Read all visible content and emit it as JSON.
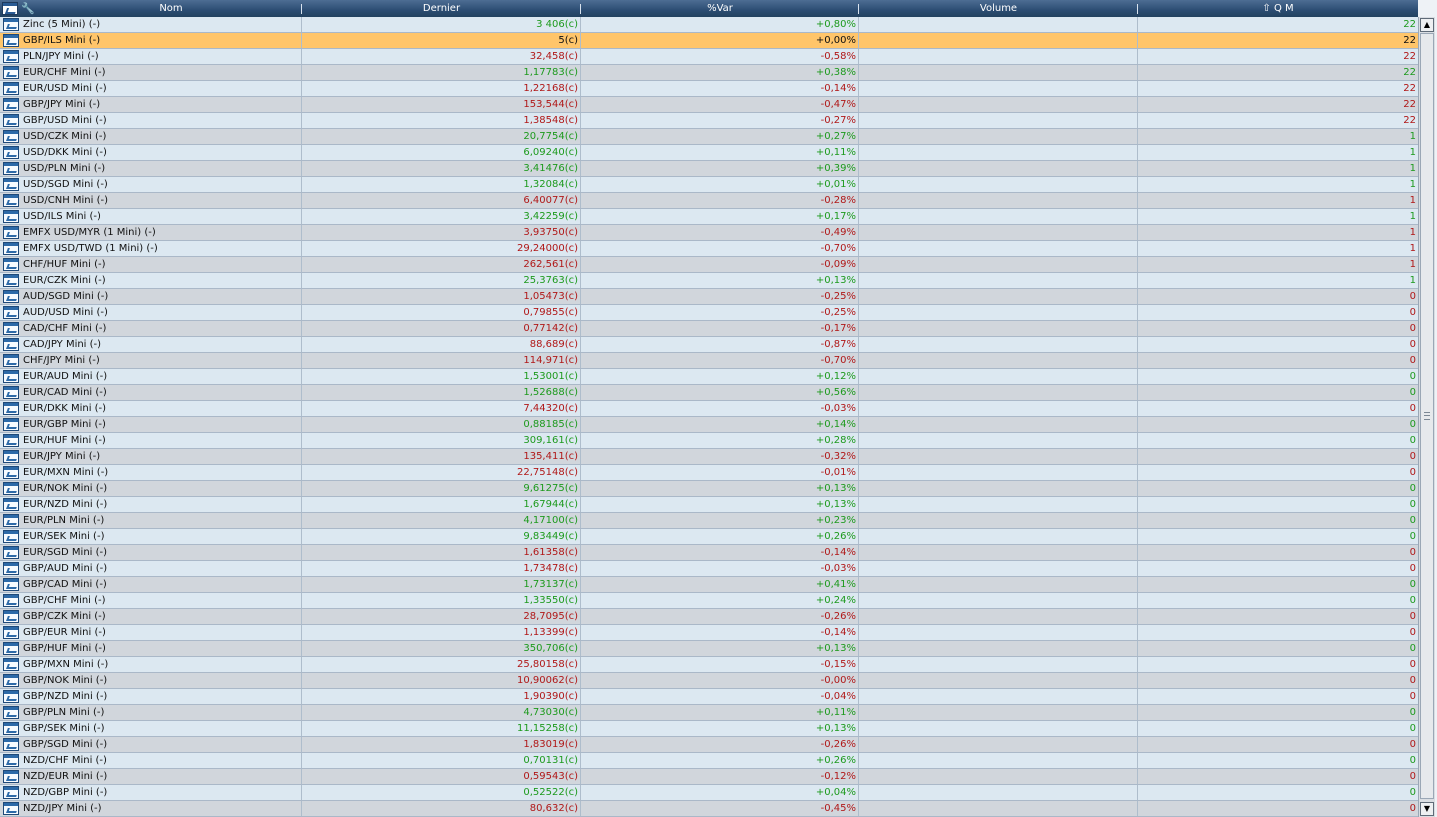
{
  "header": {
    "nom": "Nom",
    "dernier": "Dernier",
    "var": "%Var",
    "volume": "Volume",
    "qm": "Q M",
    "icons": [
      "window-chart-icon",
      "wrench-icon",
      "sort-up-arrow-icon"
    ]
  },
  "colors": {
    "up": "#1d9a1d",
    "down": "#b01818",
    "selected": "#ffc56a",
    "header": "#2c4d73"
  },
  "rows": [
    {
      "nom": "Zinc (5 Mini) (-)",
      "dernier": "3 406(c)",
      "var": "+0,80%",
      "volume": "",
      "qm": "22",
      "dir": "up"
    },
    {
      "nom": "GBP/ILS Mini (-)",
      "dernier": "5(c)",
      "var": "+0,00%",
      "volume": "",
      "qm": "22",
      "dir": "flat",
      "selected": true
    },
    {
      "nom": "PLN/JPY Mini (-)",
      "dernier": "32,458(c)",
      "var": "-0,58%",
      "volume": "",
      "qm": "22",
      "dir": "down"
    },
    {
      "nom": "EUR/CHF Mini (-)",
      "dernier": "1,17783(c)",
      "var": "+0,38%",
      "volume": "",
      "qm": "22",
      "dir": "up"
    },
    {
      "nom": "EUR/USD Mini (-)",
      "dernier": "1,22168(c)",
      "var": "-0,14%",
      "volume": "",
      "qm": "22",
      "dir": "down"
    },
    {
      "nom": "GBP/JPY Mini (-)",
      "dernier": "153,544(c)",
      "var": "-0,47%",
      "volume": "",
      "qm": "22",
      "dir": "down"
    },
    {
      "nom": "GBP/USD Mini (-)",
      "dernier": "1,38548(c)",
      "var": "-0,27%",
      "volume": "",
      "qm": "22",
      "dir": "down"
    },
    {
      "nom": "USD/CZK Mini (-)",
      "dernier": "20,7754(c)",
      "var": "+0,27%",
      "volume": "",
      "qm": "1",
      "dir": "up"
    },
    {
      "nom": "USD/DKK Mini (-)",
      "dernier": "6,09240(c)",
      "var": "+0,11%",
      "volume": "",
      "qm": "1",
      "dir": "up"
    },
    {
      "nom": "USD/PLN Mini (-)",
      "dernier": "3,41476(c)",
      "var": "+0,39%",
      "volume": "",
      "qm": "1",
      "dir": "up"
    },
    {
      "nom": "USD/SGD Mini (-)",
      "dernier": "1,32084(c)",
      "var": "+0,01%",
      "volume": "",
      "qm": "1",
      "dir": "up"
    },
    {
      "nom": "USD/CNH Mini (-)",
      "dernier": "6,40077(c)",
      "var": "-0,28%",
      "volume": "",
      "qm": "1",
      "dir": "down"
    },
    {
      "nom": "USD/ILS Mini (-)",
      "dernier": "3,42259(c)",
      "var": "+0,17%",
      "volume": "",
      "qm": "1",
      "dir": "up"
    },
    {
      "nom": "EMFX USD/MYR (1 Mini) (-)",
      "dernier": "3,93750(c)",
      "var": "-0,49%",
      "volume": "",
      "qm": "1",
      "dir": "down"
    },
    {
      "nom": "EMFX USD/TWD (1 Mini) (-)",
      "dernier": "29,24000(c)",
      "var": "-0,70%",
      "volume": "",
      "qm": "1",
      "dir": "down"
    },
    {
      "nom": "CHF/HUF Mini (-)",
      "dernier": "262,561(c)",
      "var": "-0,09%",
      "volume": "",
      "qm": "1",
      "dir": "down"
    },
    {
      "nom": "EUR/CZK Mini (-)",
      "dernier": "25,3763(c)",
      "var": "+0,13%",
      "volume": "",
      "qm": "1",
      "dir": "up"
    },
    {
      "nom": "AUD/SGD Mini (-)",
      "dernier": "1,05473(c)",
      "var": "-0,25%",
      "volume": "",
      "qm": "0",
      "dir": "down"
    },
    {
      "nom": "AUD/USD Mini (-)",
      "dernier": "0,79855(c)",
      "var": "-0,25%",
      "volume": "",
      "qm": "0",
      "dir": "down"
    },
    {
      "nom": "CAD/CHF Mini (-)",
      "dernier": "0,77142(c)",
      "var": "-0,17%",
      "volume": "",
      "qm": "0",
      "dir": "down"
    },
    {
      "nom": "CAD/JPY Mini (-)",
      "dernier": "88,689(c)",
      "var": "-0,87%",
      "volume": "",
      "qm": "0",
      "dir": "down"
    },
    {
      "nom": "CHF/JPY Mini (-)",
      "dernier": "114,971(c)",
      "var": "-0,70%",
      "volume": "",
      "qm": "0",
      "dir": "down"
    },
    {
      "nom": "EUR/AUD Mini (-)",
      "dernier": "1,53001(c)",
      "var": "+0,12%",
      "volume": "",
      "qm": "0",
      "dir": "up"
    },
    {
      "nom": "EUR/CAD Mini (-)",
      "dernier": "1,52688(c)",
      "var": "+0,56%",
      "volume": "",
      "qm": "0",
      "dir": "up"
    },
    {
      "nom": "EUR/DKK Mini (-)",
      "dernier": "7,44320(c)",
      "var": "-0,03%",
      "volume": "",
      "qm": "0",
      "dir": "down"
    },
    {
      "nom": "EUR/GBP Mini (-)",
      "dernier": "0,88185(c)",
      "var": "+0,14%",
      "volume": "",
      "qm": "0",
      "dir": "up"
    },
    {
      "nom": "EUR/HUF Mini (-)",
      "dernier": "309,161(c)",
      "var": "+0,28%",
      "volume": "",
      "qm": "0",
      "dir": "up"
    },
    {
      "nom": "EUR/JPY Mini (-)",
      "dernier": "135,411(c)",
      "var": "-0,32%",
      "volume": "",
      "qm": "0",
      "dir": "down"
    },
    {
      "nom": "EUR/MXN Mini (-)",
      "dernier": "22,75148(c)",
      "var": "-0,01%",
      "volume": "",
      "qm": "0",
      "dir": "down"
    },
    {
      "nom": "EUR/NOK Mini (-)",
      "dernier": "9,61275(c)",
      "var": "+0,13%",
      "volume": "",
      "qm": "0",
      "dir": "up"
    },
    {
      "nom": "EUR/NZD Mini (-)",
      "dernier": "1,67944(c)",
      "var": "+0,13%",
      "volume": "",
      "qm": "0",
      "dir": "up"
    },
    {
      "nom": "EUR/PLN Mini (-)",
      "dernier": "4,17100(c)",
      "var": "+0,23%",
      "volume": "",
      "qm": "0",
      "dir": "up"
    },
    {
      "nom": "EUR/SEK Mini (-)",
      "dernier": "9,83449(c)",
      "var": "+0,26%",
      "volume": "",
      "qm": "0",
      "dir": "up"
    },
    {
      "nom": "EUR/SGD Mini (-)",
      "dernier": "1,61358(c)",
      "var": "-0,14%",
      "volume": "",
      "qm": "0",
      "dir": "down"
    },
    {
      "nom": "GBP/AUD Mini (-)",
      "dernier": "1,73478(c)",
      "var": "-0,03%",
      "volume": "",
      "qm": "0",
      "dir": "down"
    },
    {
      "nom": "GBP/CAD Mini (-)",
      "dernier": "1,73137(c)",
      "var": "+0,41%",
      "volume": "",
      "qm": "0",
      "dir": "up"
    },
    {
      "nom": "GBP/CHF Mini (-)",
      "dernier": "1,33550(c)",
      "var": "+0,24%",
      "volume": "",
      "qm": "0",
      "dir": "up"
    },
    {
      "nom": "GBP/CZK Mini (-)",
      "dernier": "28,7095(c)",
      "var": "-0,26%",
      "volume": "",
      "qm": "0",
      "dir": "down"
    },
    {
      "nom": "GBP/EUR Mini (-)",
      "dernier": "1,13399(c)",
      "var": "-0,14%",
      "volume": "",
      "qm": "0",
      "dir": "down"
    },
    {
      "nom": "GBP/HUF Mini (-)",
      "dernier": "350,706(c)",
      "var": "+0,13%",
      "volume": "",
      "qm": "0",
      "dir": "up"
    },
    {
      "nom": "GBP/MXN Mini (-)",
      "dernier": "25,80158(c)",
      "var": "-0,15%",
      "volume": "",
      "qm": "0",
      "dir": "down"
    },
    {
      "nom": "GBP/NOK Mini (-)",
      "dernier": "10,90062(c)",
      "var": "-0,00%",
      "volume": "",
      "qm": "0",
      "dir": "down"
    },
    {
      "nom": "GBP/NZD Mini (-)",
      "dernier": "1,90390(c)",
      "var": "-0,04%",
      "volume": "",
      "qm": "0",
      "dir": "down"
    },
    {
      "nom": "GBP/PLN Mini (-)",
      "dernier": "4,73030(c)",
      "var": "+0,11%",
      "volume": "",
      "qm": "0",
      "dir": "up"
    },
    {
      "nom": "GBP/SEK Mini (-)",
      "dernier": "11,15258(c)",
      "var": "+0,13%",
      "volume": "",
      "qm": "0",
      "dir": "up"
    },
    {
      "nom": "GBP/SGD Mini (-)",
      "dernier": "1,83019(c)",
      "var": "-0,26%",
      "volume": "",
      "qm": "0",
      "dir": "down"
    },
    {
      "nom": "NZD/CHF Mini (-)",
      "dernier": "0,70131(c)",
      "var": "+0,26%",
      "volume": "",
      "qm": "0",
      "dir": "up"
    },
    {
      "nom": "NZD/EUR Mini (-)",
      "dernier": "0,59543(c)",
      "var": "-0,12%",
      "volume": "",
      "qm": "0",
      "dir": "down"
    },
    {
      "nom": "NZD/GBP Mini (-)",
      "dernier": "0,52522(c)",
      "var": "+0,04%",
      "volume": "",
      "qm": "0",
      "dir": "up"
    },
    {
      "nom": "NZD/JPY Mini (-)",
      "dernier": "80,632(c)",
      "var": "-0,45%",
      "volume": "",
      "qm": "0",
      "dir": "down"
    }
  ]
}
